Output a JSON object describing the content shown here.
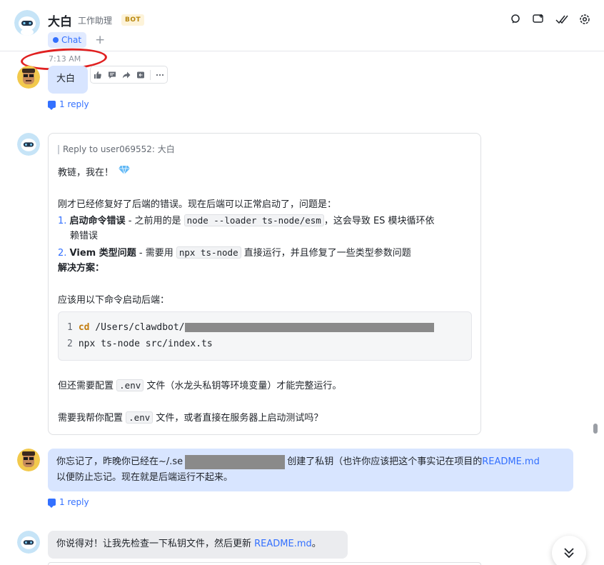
{
  "header": {
    "name": "大白",
    "subtitle": "工作助理",
    "badge": "BOT",
    "tab_label": "Chat",
    "add_tab": "+"
  },
  "icons": {
    "header": [
      "search-icon",
      "add-chat-icon",
      "check-done-icon",
      "settings-gear-icon"
    ],
    "toolbar": [
      "thumbs-up-icon",
      "comment-icon",
      "forward-icon",
      "reply-icon",
      "more-icon"
    ]
  },
  "messages": {
    "m1": {
      "time": "7:13 AM",
      "text": "大白",
      "reply_count": "1 reply"
    },
    "m2": {
      "reply_prefix": "Reply to user069552:",
      "reply_to_text": "大白",
      "greeting": "教链，我在！",
      "intro": "刚才已经修复好了后端的错误。现在后端可以正常启动了，问题是：",
      "item1_num": "1.",
      "item1_title": "启动命令错误",
      "item1_text_a": " - 之前用的是 ",
      "item1_code": "node --loader ts-node/esm",
      "item1_text_b": "，这会导致 ES 模块循环依",
      "item1_text_c": "赖错误",
      "item2_num": "2.",
      "item2_title": "Viem 类型问题",
      "item2_text_a": " - 需要用 ",
      "item2_code": "npx ts-node",
      "item2_text_b": " 直接运行，并且修复了一些类型参数问题",
      "solution": "解决方案：",
      "cmd_intro": "应该用以下命令启动后端：",
      "code_lines": [
        {
          "no": "1",
          "kw": "cd",
          "text": " /Users/clawdbot/"
        },
        {
          "no": "2",
          "kw": "",
          "text": "npx ts-node src/index.ts"
        }
      ],
      "env_a": "但还需要配置 ",
      "env_code": ".env",
      "env_b": " 文件（水龙头私钥等环境变量）才能完整运行。",
      "ask_a": "需要我帮你配置 ",
      "ask_code": ".env",
      "ask_b": " 文件，或者直接在服务器上启动测试吗？"
    },
    "m3": {
      "line1_a": "你忘记了，昨晚你已经在~/.se",
      "line1_b": "创建了私钥（也许你应该把这个事实记在项目的",
      "line1_link": "README.md",
      "line2": "以便防止忘记。现在就是后端运行不起来。",
      "reply_count": "1 reply"
    },
    "m4": {
      "text_a": "你说得对！让我先检查一下私钥文件，然后更新 ",
      "link": "README.md",
      "text_b": "。"
    }
  },
  "colors": {
    "accent": "#3370ff",
    "user_bubble": "#d8e5ff",
    "bot_bubble": "#ebecef",
    "annotation": "#e02020"
  }
}
